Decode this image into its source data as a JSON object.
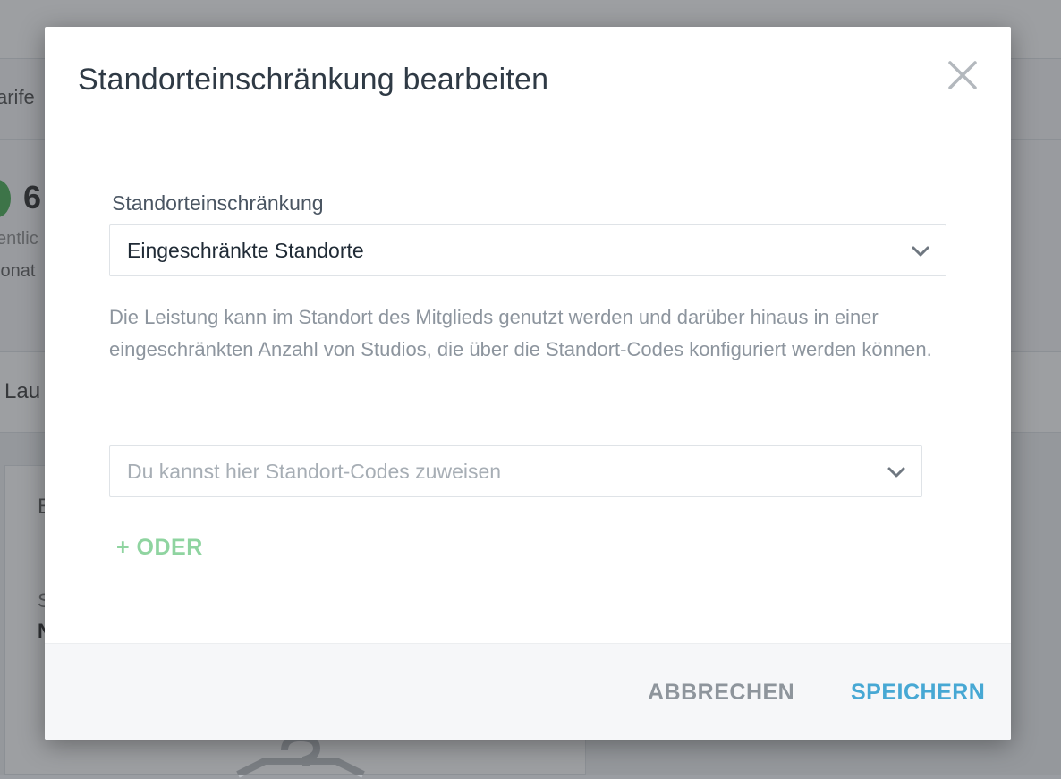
{
  "background": {
    "tab_partial": "arife",
    "stat_number": "6",
    "stat_sub1": "entlic",
    "stat_sub2": "lonat",
    "section_partial": "Lau",
    "card_row1_partial": "B",
    "card_row2_a": "S",
    "card_row2_b": "N"
  },
  "modal": {
    "title": "Standorteinschränkung bearbeiten",
    "close_icon": "close-icon",
    "field_label": "Standorteinschränkung",
    "select_value": "Eingeschränkte Standorte",
    "description": "Die Leistung kann im Standort des Mitglieds genutzt werden und darüber hinaus in einer eingeschränkten Anzahl von Studios, die über die Standort-Codes konfiguriert werden können.",
    "codes_placeholder": "Du kannst hier Standort-Codes zuweisen",
    "oder_link": "+ ODER",
    "cancel_label": "ABBRECHEN",
    "save_label": "SPEICHERN"
  },
  "colors": {
    "accent_blue": "#47a8d4",
    "accent_green": "#8fd4a0",
    "title_text": "#2f3a45",
    "muted_text": "#8d959e"
  }
}
